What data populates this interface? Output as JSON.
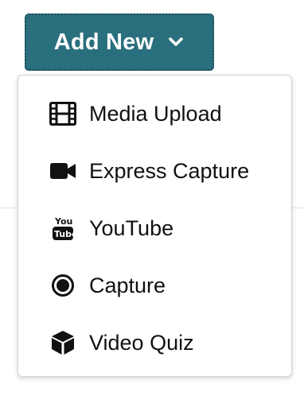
{
  "button": {
    "label": "Add New",
    "icon": "chevron-down-icon",
    "bg_color": "#2a6f7d"
  },
  "menu": {
    "items": [
      {
        "label": "Media Upload",
        "icon": "film-icon"
      },
      {
        "label": "Express Capture",
        "icon": "video-camera-icon"
      },
      {
        "label": "YouTube",
        "icon": "youtube-icon"
      },
      {
        "label": "Capture",
        "icon": "record-icon"
      },
      {
        "label": "Video Quiz",
        "icon": "cube-icon"
      }
    ]
  }
}
